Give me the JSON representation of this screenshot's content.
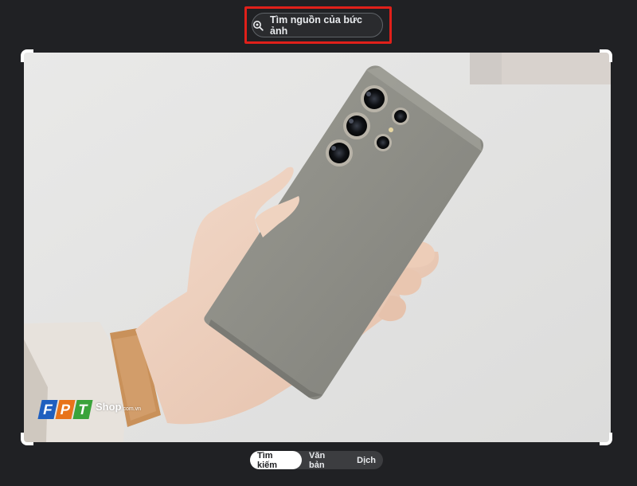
{
  "source_search": {
    "label": "Tìm nguồn của bức ảnh",
    "icon": "lens-search-icon"
  },
  "tabs": [
    {
      "label": "Tìm kiếm",
      "active": true
    },
    {
      "label": "Văn bản",
      "active": false
    },
    {
      "label": "Dịch",
      "active": false
    }
  ],
  "watermark": {
    "letters": [
      "F",
      "P",
      "T"
    ],
    "letter_colors": [
      "#1f5fbf",
      "#e8731a",
      "#3aa33a"
    ],
    "shop": "Shop",
    "domain": ".com.vn"
  },
  "colors": {
    "background": "#202124",
    "highlight": "#e0201a",
    "active_tab": "#ffffff"
  }
}
